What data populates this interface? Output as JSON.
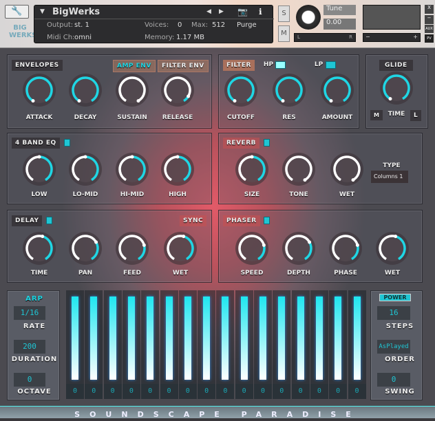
{
  "header": {
    "title": "BigWerks",
    "logo": "BIG WERKS",
    "output_label": "Output:",
    "output_value": "st. 1",
    "midi_label": "Midi Ch:",
    "midi_value": "omni",
    "voices_label": "Voices:",
    "voices_value": "0",
    "max_label": "Max:",
    "max_value": "512",
    "memory_label": "Memory:",
    "memory_value": "1.17 MB",
    "purge": "Purge",
    "solo": "S",
    "mute": "M",
    "tune_label": "Tune",
    "tune_value": "0.00",
    "pan_l": "L",
    "pan_r": "R",
    "vol_minus": "−",
    "vol_plus": "+",
    "close": "X",
    "minimize": "−",
    "aux": "AUX",
    "pv": "PV"
  },
  "envelopes": {
    "title": "ENVELOPES",
    "tabs": [
      "AMP ENV",
      "FILTER ENV"
    ],
    "active_tab": "AMP ENV",
    "knobs": [
      {
        "label": "ATTACK",
        "value": 0
      },
      {
        "label": "DECAY",
        "value": 0
      },
      {
        "label": "SUSTAIN",
        "value": 1
      },
      {
        "label": "RELEASE",
        "value": 0.9
      }
    ]
  },
  "filter": {
    "title": "FILTER",
    "hp": "HP",
    "lp": "LP",
    "knobs": [
      {
        "label": "CUTOFF",
        "value": 0
      },
      {
        "label": "RES",
        "value": 0
      },
      {
        "label": "AMOUNT",
        "value": 0
      }
    ]
  },
  "glide": {
    "title": "GLIDE",
    "knob": {
      "label": "TIME",
      "value": 0
    },
    "m": "M",
    "l": "L"
  },
  "eq": {
    "title": "4 BAND EQ",
    "enabled": true,
    "knobs": [
      {
        "label": "LOW",
        "value": 0.5
      },
      {
        "label": "LO-MID",
        "value": 0.5
      },
      {
        "label": "HI-MID",
        "value": 0.5
      },
      {
        "label": "HIGH",
        "value": 0.5
      }
    ]
  },
  "reverb": {
    "title": "REVERB",
    "enabled": true,
    "type_label": "TYPE",
    "type_value": "Columns 1",
    "knobs": [
      {
        "label": "SIZE",
        "value": 0.5
      },
      {
        "label": "TONE",
        "value": 1
      },
      {
        "label": "WET",
        "value": 1
      }
    ]
  },
  "delay": {
    "title": "DELAY",
    "enabled": true,
    "sync": "SYNC",
    "knobs": [
      {
        "label": "TIME",
        "value": 0.55
      },
      {
        "label": "PAN",
        "value": 0.7
      },
      {
        "label": "FEED",
        "value": 0.75
      },
      {
        "label": "WET",
        "value": 0.55
      }
    ]
  },
  "phaser": {
    "title": "PHASER",
    "enabled": true,
    "knobs": [
      {
        "label": "SPEED",
        "value": 0.75
      },
      {
        "label": "DEPTH",
        "value": 0.7
      },
      {
        "label": "PHASE",
        "value": 0.75
      },
      {
        "label": "WET",
        "value": 0.55
      }
    ]
  },
  "arp": {
    "title": "ARP",
    "rate_label": "RATE",
    "rate": "1/16",
    "duration_label": "DURATION",
    "duration": "200",
    "octave_label": "OCTAVE",
    "octave": "0",
    "power": "POWER",
    "steps_label": "STEPS",
    "steps": "16",
    "order_label": "ORDER",
    "order": "AsPlayed",
    "swing_label": "SWING",
    "swing": "0",
    "step_values": [
      "0",
      "0",
      "0",
      "0",
      "0",
      "0",
      "0",
      "0",
      "0",
      "0",
      "0",
      "0",
      "0",
      "0",
      "0",
      "0"
    ],
    "step_levels": [
      1,
      1,
      1,
      1,
      1,
      1,
      1,
      1,
      1,
      1,
      1,
      1,
      1,
      1,
      1,
      1
    ]
  },
  "footer": "SOUNDSCAPE PARADISE",
  "colors": {
    "accent": "#1fc6d4",
    "knob_value": "#ffffff"
  }
}
